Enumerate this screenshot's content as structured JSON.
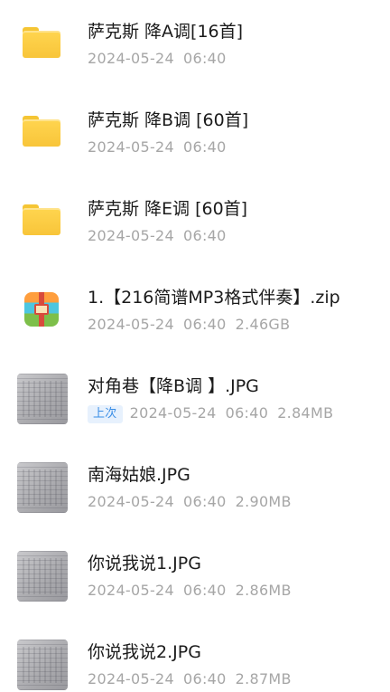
{
  "files": [
    {
      "type": "folder",
      "name": "萨克斯  降A调[16首]",
      "date": "2024-05-24",
      "time": "06:40",
      "size": ""
    },
    {
      "type": "folder",
      "name": "萨克斯  降B调 [60首]",
      "date": "2024-05-24",
      "time": "06:40",
      "size": ""
    },
    {
      "type": "folder",
      "name": "萨克斯  降E调 [60首]",
      "date": "2024-05-24",
      "time": "06:40",
      "size": ""
    },
    {
      "type": "archive",
      "name": "1.【216简谱MP3格式伴奏】.zip",
      "date": "2024-05-24",
      "time": "06:40",
      "size": "2.46GB"
    },
    {
      "type": "image",
      "name": "对角巷【降B调 】.JPG",
      "badge": "上次",
      "date": "2024-05-24",
      "time": "06:40",
      "size": "2.84MB"
    },
    {
      "type": "image",
      "name": "南海姑娘.JPG",
      "date": "2024-05-24",
      "time": "06:40",
      "size": "2.90MB"
    },
    {
      "type": "image",
      "name": "你说我说1.JPG",
      "date": "2024-05-24",
      "time": "06:40",
      "size": "2.86MB"
    },
    {
      "type": "image",
      "name": "你说我说2.JPG",
      "date": "2024-05-24",
      "time": "06:40",
      "size": "2.87MB"
    }
  ],
  "icons": {
    "folder": "folder-icon",
    "archive": "archive-icon",
    "image": "image-thumbnail"
  },
  "colors": {
    "folder": "#f8c53a",
    "badge_text": "#3a8ee6",
    "badge_bg": "#e7f1fd",
    "meta_text": "#a6a6a6"
  }
}
